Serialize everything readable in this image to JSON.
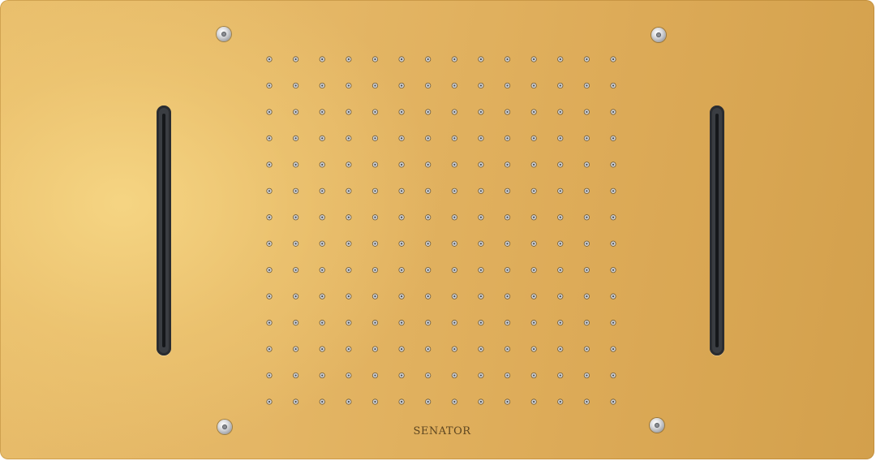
{
  "product": {
    "brand_label": "SENATOR",
    "finish_color": "#e3b563",
    "slot_color": "#3a3d42",
    "screw_color": "#c9cbcf",
    "nozzle_color": "#cfd1d4"
  },
  "nozzle_grid": {
    "rows": 14,
    "columns": 14
  },
  "features": [
    {
      "name": "waterfall-slot-left"
    },
    {
      "name": "waterfall-slot-right"
    }
  ]
}
